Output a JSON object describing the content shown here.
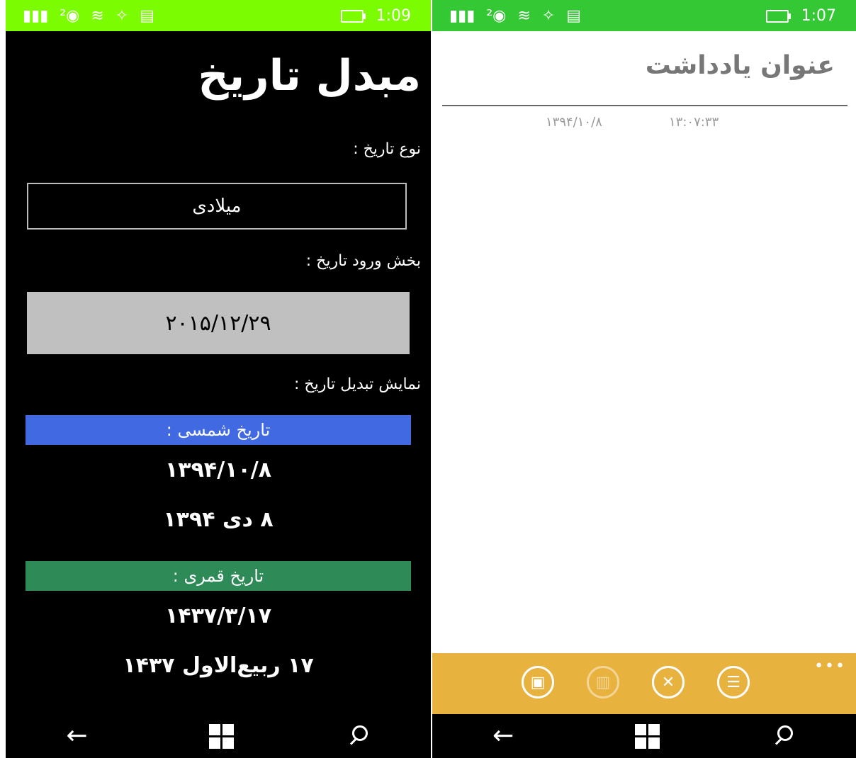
{
  "left": {
    "status": {
      "time": "1:09",
      "icons": [
        "signal-icon",
        "sim-2-icon",
        "wifi-icon",
        "bluetooth-icon",
        "message-icon"
      ]
    },
    "title": "مبدل تاریخ",
    "date_type_label": "نوع تاریخ :",
    "date_type_value": "میلادی",
    "input_label": "بخش ورود تاریخ :",
    "input_value": "۲۰۱۵/۱۲/۲۹",
    "display_label": "نمایش تبدیل تاریخ :",
    "shamsi": {
      "header": "تاریخ شمسی :",
      "color": "#4169e1",
      "numeric": "۱۳۹۴/۱۰/۸",
      "text": "۸ دی ۱۳۹۴"
    },
    "qamari": {
      "header": "تاریخ قمری :",
      "color": "#2e8b57",
      "numeric": "۱۴۳۷/۳/۱۷",
      "text": "۱۷ ربیع‌الاول ۱۴۳۷"
    },
    "nav": {
      "back": "←",
      "start": "windows-icon",
      "search": "search-icon"
    }
  },
  "right": {
    "status": {
      "time": "1:07"
    },
    "note_title": "عنوان یادداشت",
    "date": "۱۳۹۴/۱۰/۸",
    "time": "۱۳:۰۷:۳۳",
    "appbar": {
      "color": "#e8b23e",
      "more": "•••",
      "buttons": [
        "save-icon",
        "delete-icon",
        "close-icon",
        "list-icon"
      ]
    },
    "nav": {
      "back": "←"
    }
  }
}
